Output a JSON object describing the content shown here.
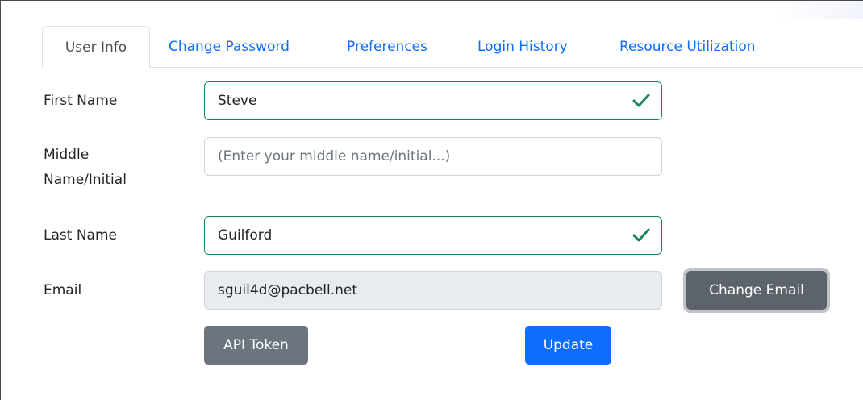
{
  "tabs": [
    {
      "label": "User Info",
      "active": true
    },
    {
      "label": "Change Password",
      "active": false
    },
    {
      "label": "Preferences",
      "active": false
    },
    {
      "label": "Login History",
      "active": false
    },
    {
      "label": "Resource Utilization",
      "active": false
    }
  ],
  "form": {
    "first_name": {
      "label": "First Name",
      "value": "Steve"
    },
    "middle_name": {
      "label_line1": "Middle",
      "label_line2": "Name/Initial",
      "placeholder": "(Enter your middle name/initial...)"
    },
    "last_name": {
      "label": "Last Name",
      "value": "Guilford"
    },
    "email": {
      "label": "Email",
      "value": "sguil4d@pacbell.net"
    }
  },
  "buttons": {
    "change_email": "Change Email",
    "api_token": "API Token",
    "update": "Update"
  },
  "icons": {
    "valid": "check-icon"
  },
  "colors": {
    "link": "#0d6efd",
    "valid": "#198754",
    "secondary": "#6c757d",
    "primary": "#0d6efd"
  }
}
